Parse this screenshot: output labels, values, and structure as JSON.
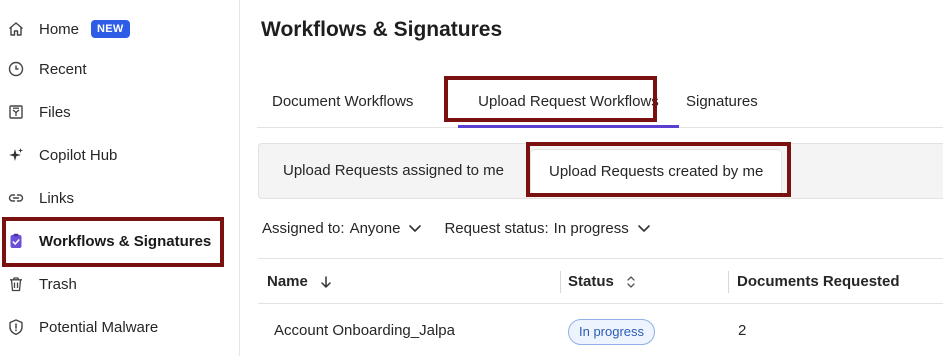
{
  "sidebar": {
    "items": [
      {
        "label": "Home",
        "icon": "home-icon",
        "badge": "NEW"
      },
      {
        "label": "Recent",
        "icon": "clock-icon"
      },
      {
        "label": "Files",
        "icon": "files-icon"
      },
      {
        "label": "Copilot Hub",
        "icon": "sparkle-icon"
      },
      {
        "label": "Links",
        "icon": "link-icon"
      },
      {
        "label": "Workflows & Signatures",
        "icon": "clipboard-check-icon",
        "active": true
      },
      {
        "label": "Trash",
        "icon": "trash-icon"
      },
      {
        "label": "Potential Malware",
        "icon": "shield-alert-icon"
      }
    ]
  },
  "main": {
    "title": "Workflows & Signatures",
    "tabs": [
      {
        "label": "Document Workflows"
      },
      {
        "label": "Upload Request Workflows",
        "selected": true
      },
      {
        "label": "Signatures"
      }
    ],
    "subtabs": [
      {
        "label": "Upload Requests assigned to me"
      },
      {
        "label": "Upload Requests created by me",
        "selected": true
      }
    ],
    "filters": {
      "assigned_to_label": "Assigned to:",
      "assigned_to_value": "Anyone",
      "status_label": "Request status:",
      "status_value": "In progress"
    },
    "table": {
      "columns": [
        {
          "label": "Name",
          "sort": "descending"
        },
        {
          "label": "Status",
          "sort": "sortable"
        },
        {
          "label": "Documents Requested"
        }
      ],
      "rows": [
        {
          "name": "Account Onboarding_Jalpa",
          "status": "In progress",
          "documents_requested": "2"
        }
      ]
    }
  },
  "colors": {
    "highlight_box": "#7a1111",
    "tab_underline": "#5b3fd1",
    "new_badge": "#2e5ce6",
    "status_pill_border": "#8fb1ea",
    "status_pill_text": "#2c5bb5"
  }
}
